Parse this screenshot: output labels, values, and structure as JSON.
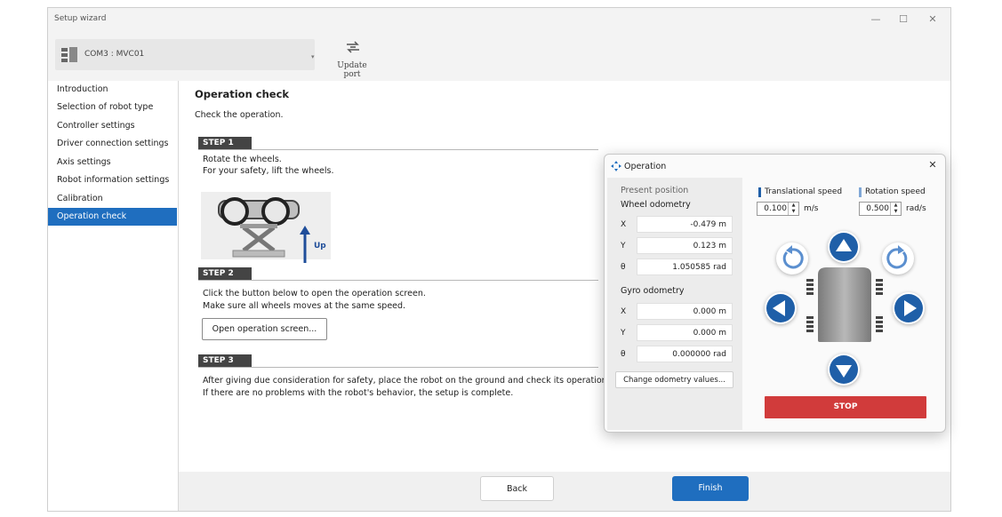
{
  "window": {
    "title": "Setup wizard",
    "minimize": "—",
    "maximize": "☐",
    "close": "✕"
  },
  "toolbar": {
    "port": "COM3 : MVC01",
    "port_dropdown": "▾",
    "update_label": "Update port"
  },
  "sidebar": {
    "items": [
      {
        "label": "Introduction"
      },
      {
        "label": "Selection of robot type"
      },
      {
        "label": "Controller settings"
      },
      {
        "label": "Driver connection settings"
      },
      {
        "label": "Axis settings"
      },
      {
        "label": "Robot information settings"
      },
      {
        "label": "Calibration"
      },
      {
        "label": "Operation check",
        "active": true
      }
    ]
  },
  "main": {
    "title": "Operation check",
    "description": "Check the operation.",
    "step1": {
      "tag": "STEP 1",
      "line1": "Rotate the wheels.",
      "line2": "For your safety, lift the wheels.",
      "up_label": "Up"
    },
    "step2": {
      "tag": "STEP 2",
      "line1": "Click the button below to open the operation screen.",
      "line2": "Make sure all wheels moves at the same speed.",
      "button": "Open operation screen..."
    },
    "step3": {
      "tag": "STEP 3",
      "line1": "After giving due consideration for safety, place the robot on the ground and check its operation.",
      "line2": "If there are no problems with the robot's behavior, the setup is complete."
    }
  },
  "footer": {
    "back": "Back",
    "finish": "Finish"
  },
  "operation": {
    "title": "Operation",
    "close": "✕",
    "present_position": "Present position",
    "wheel_odometry": {
      "label": "Wheel odometry",
      "x_label": "X",
      "x": "-0.479  m",
      "y_label": "Y",
      "y": "0.123  m",
      "theta_label": "θ",
      "theta": "1.050585 rad"
    },
    "gyro_odometry": {
      "label": "Gyro odometry",
      "x_label": "X",
      "x": "0.000  m",
      "y_label": "Y",
      "y": "0.000  m",
      "theta_label": "θ",
      "theta": "0.000000 rad"
    },
    "change_button": "Change odometry values...",
    "translational": {
      "label": "Translational speed",
      "value": "0.100",
      "unit": "m/s"
    },
    "rotation": {
      "label": "Rotation speed",
      "value": "0.500",
      "unit": "rad/s"
    },
    "stop": "STOP",
    "colors": {
      "accent": "#1f6ebf",
      "stop": "#d13b3b",
      "translational_marker": "#1f5fa8",
      "rotation_marker": "#7fa7d6"
    }
  }
}
